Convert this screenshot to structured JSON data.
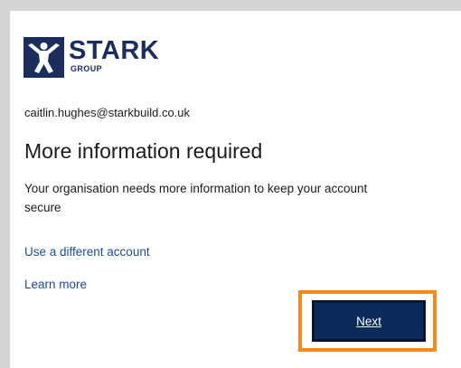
{
  "brand": {
    "name": "STARK",
    "sub": "GROUP",
    "logo_icon": "stark-figure-icon",
    "color": "#1a2d5c"
  },
  "account": {
    "email": "caitlin.hughes@starkbuild.co.uk"
  },
  "main": {
    "title": "More information required",
    "description": "Your organisation needs more information to keep your account secure"
  },
  "links": {
    "different_account": "Use a different account",
    "learn_more": "Learn more"
  },
  "actions": {
    "next_label": "Next",
    "button_color": "#0b2a5b",
    "highlight_color": "#f28c1e"
  }
}
